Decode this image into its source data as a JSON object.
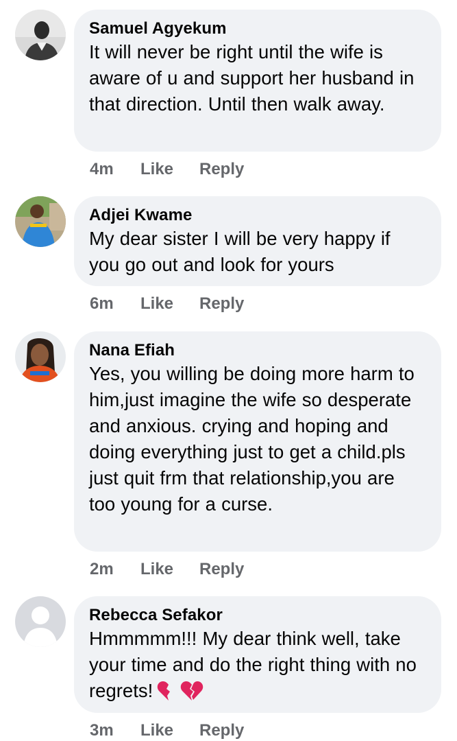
{
  "comments": [
    {
      "author": "Samuel Agyekum",
      "text": "It will never be right until the wife is aware of u and support her husband in that direction. Until then walk away.",
      "time": "4m",
      "like_label": "Like",
      "reply_label": "Reply",
      "avatar": "profile-photo-man-dark-shirt"
    },
    {
      "author": "Adjei Kwame",
      "text": "My dear sister I will be very happy if you go out and look for yours",
      "time": "6m",
      "like_label": "Like",
      "reply_label": "Reply",
      "avatar": "profile-photo-man-blue-shirt-outdoors"
    },
    {
      "author": "Nana Efiah",
      "text": "Yes, you willing be doing more harm to him,just imagine the wife so desperate and anxious. crying and hoping and doing everything just to get a child.pls just quit frm that relationship,you are too young for a curse.",
      "time": "2m",
      "like_label": "Like",
      "reply_label": "Reply",
      "avatar": "profile-photo-woman-braids"
    },
    {
      "author": "Rebecca Sefakor",
      "text": "Hmmmmm!!! My dear think well, take your time and do the right thing with no regrets!",
      "emoji": "broken-heart-icon x2",
      "time": "3m",
      "like_label": "Like",
      "reply_label": "Reply",
      "avatar": "default-profile-silhouette"
    }
  ],
  "colors": {
    "bubble": "#f0f2f5",
    "text": "#050505",
    "meta": "#65676b",
    "heart": "#e0245e"
  }
}
